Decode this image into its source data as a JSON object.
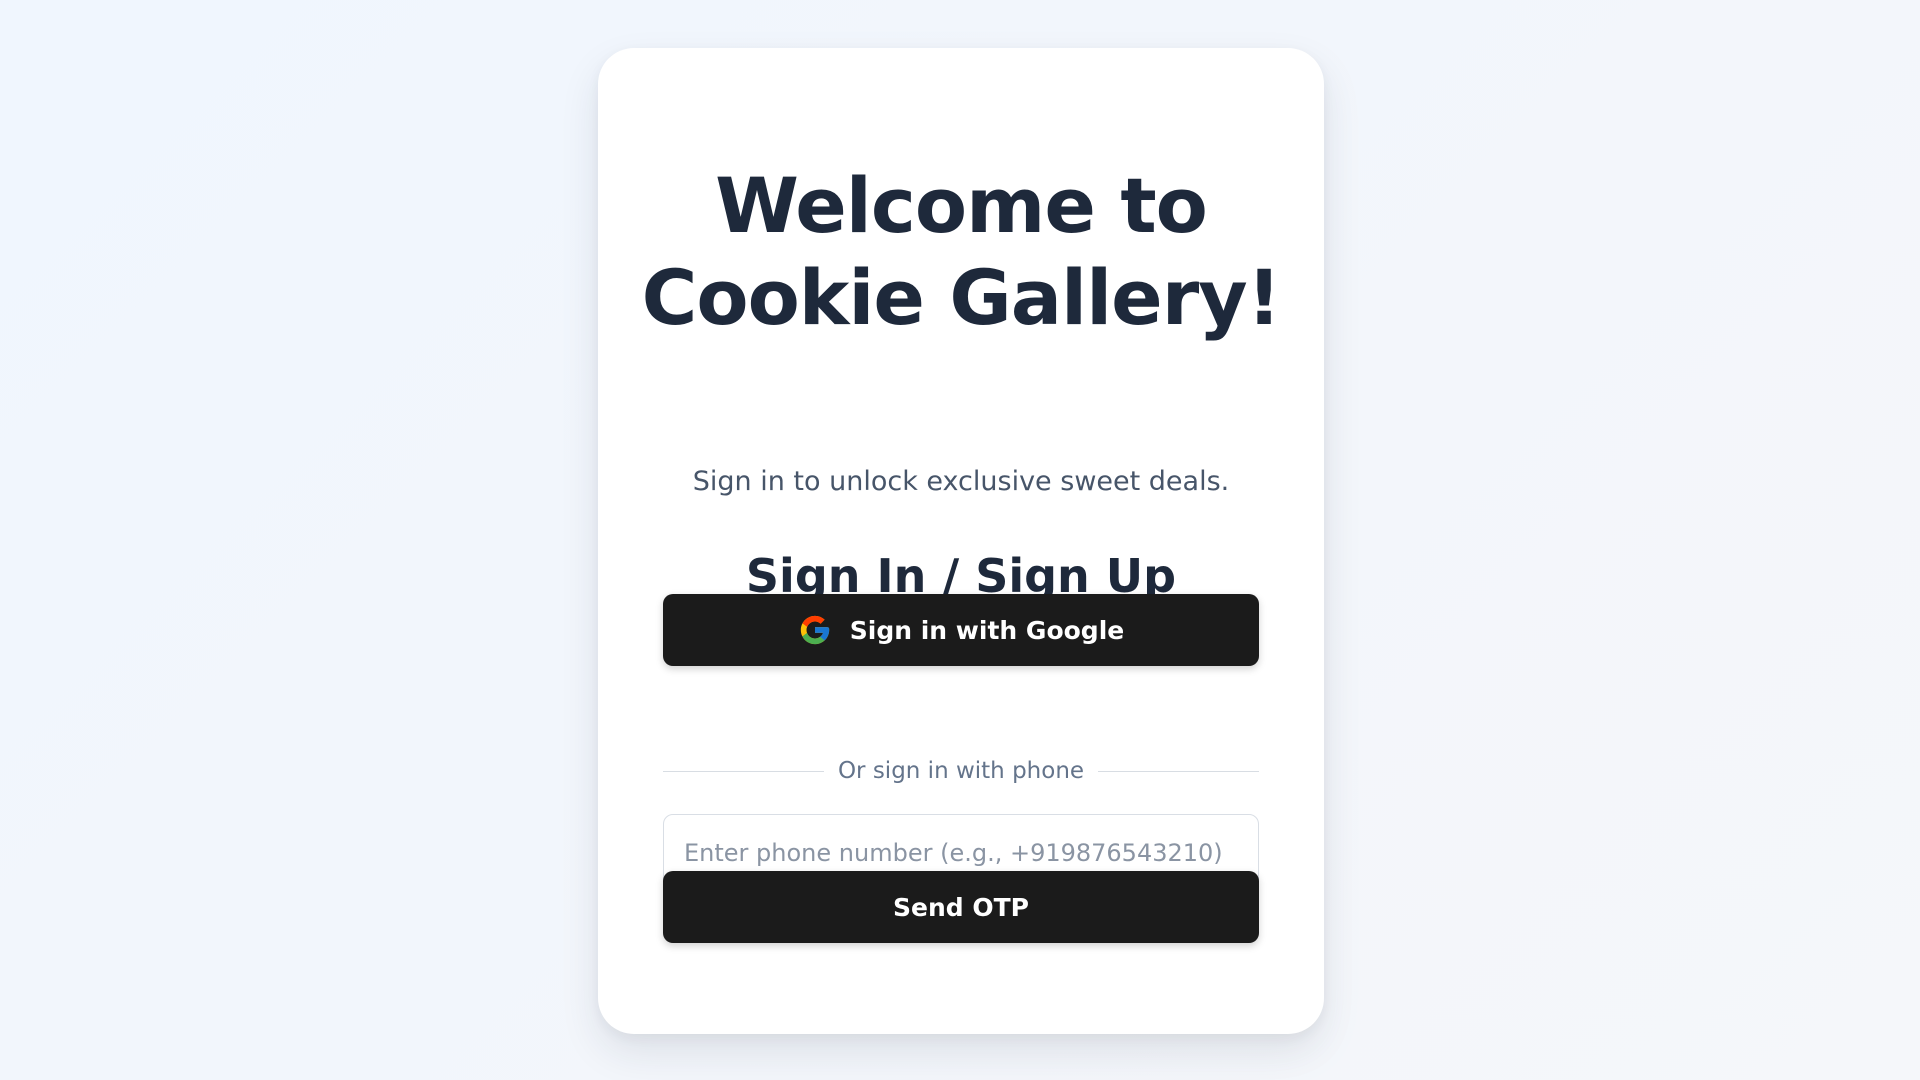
{
  "card": {
    "title": "Welcome to Cookie Gallery!",
    "subtitle": "Sign in to unlock exclusive sweet deals.",
    "section_title": "Sign In / Sign Up"
  },
  "google_button": {
    "label": "Sign in with Google",
    "icon": "google-g-icon"
  },
  "divider": {
    "text": "Or sign in with phone"
  },
  "phone_input": {
    "value": "",
    "placeholder": "Enter phone number (e.g., +919876543210)"
  },
  "otp_button": {
    "label": "Send OTP"
  },
  "colors": {
    "background": "#f0f6fe",
    "card": "#ffffff",
    "heading": "#1e293b",
    "button": "#1b1b1b",
    "button_text": "#ffffff",
    "muted_text": "#64748b"
  }
}
